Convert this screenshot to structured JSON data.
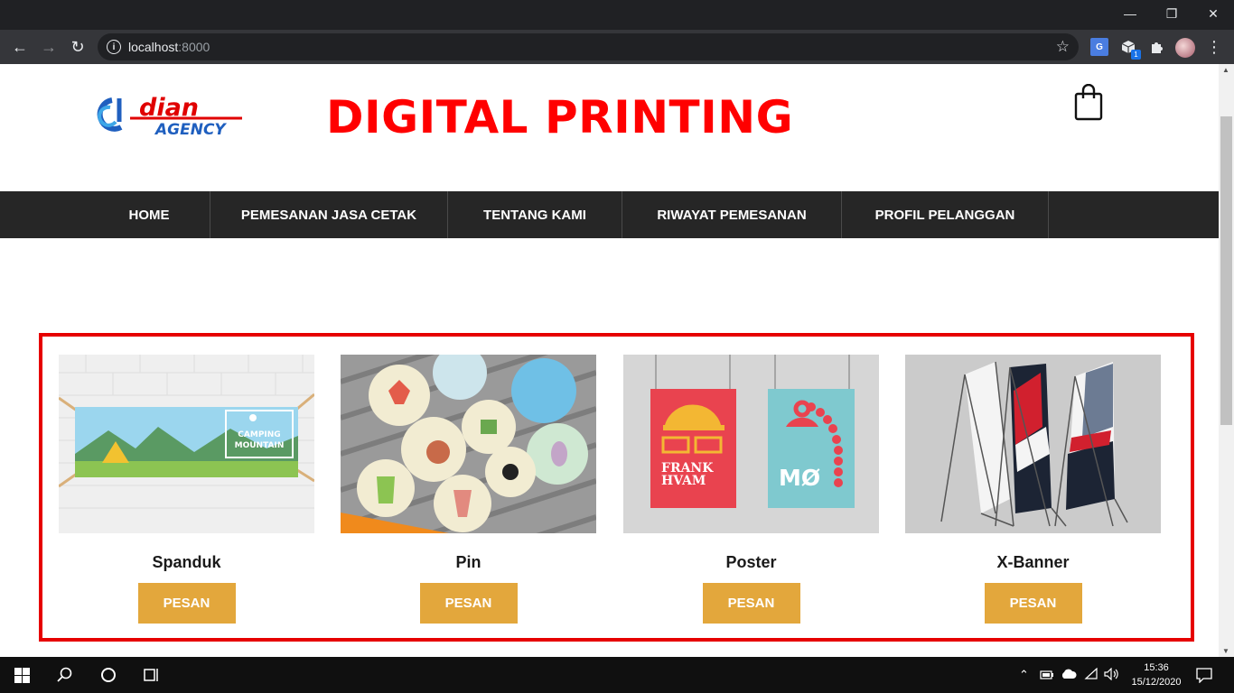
{
  "browser": {
    "window_controls": {
      "minimize": "—",
      "restore": "❐",
      "close": "✕"
    },
    "back_icon": "←",
    "forward_icon": "→",
    "reload_icon": "↻",
    "url_host": "localhost",
    "url_port": ":8000",
    "bookmark_icon": "☆",
    "extension_badge": "1",
    "menu_icon": "⋮"
  },
  "site": {
    "logo_text_top": "dian",
    "logo_text_bottom": "AGENCY",
    "title": "DIGITAL PRINTING"
  },
  "nav": {
    "items": [
      {
        "label": "HOME"
      },
      {
        "label": "PEMESANAN JASA CETAK"
      },
      {
        "label": "TENTANG KAMI"
      },
      {
        "label": "RIWAYAT PEMESANAN"
      },
      {
        "label": "PROFIL PELANGGAN"
      }
    ]
  },
  "products": [
    {
      "name": "Spanduk",
      "button": "PESAN",
      "banner_text_1": "CAMPING",
      "banner_text_2": "MOUNTAIN"
    },
    {
      "name": "Pin",
      "button": "PESAN"
    },
    {
      "name": "Poster",
      "button": "PESAN",
      "poster_text_1": "FRANK",
      "poster_text_2": "HVAM",
      "poster_text_3": "MØ"
    },
    {
      "name": "X-Banner",
      "button": "PESAN"
    }
  ],
  "colors": {
    "title_red": "#ff0000",
    "nav_bg": "#262626",
    "button_gold": "#e3a73c",
    "frame_red": "#e60000"
  },
  "taskbar": {
    "time": "15:36",
    "date": "15/12/2020"
  }
}
